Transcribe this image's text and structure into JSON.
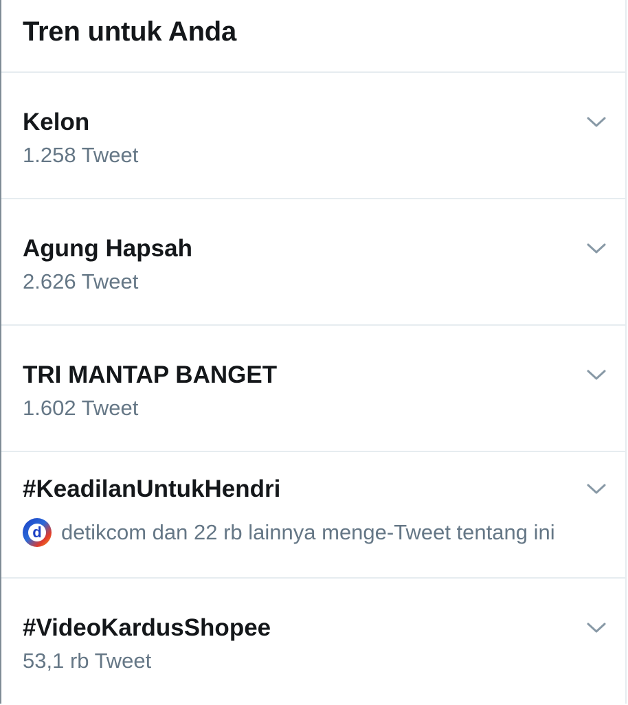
{
  "header": {
    "title": "Tren untuk Anda"
  },
  "trends": [
    {
      "name": "Kelon",
      "meta": "1.258 Tweet"
    },
    {
      "name": "Agung Hapsah",
      "meta": "2.626 Tweet"
    },
    {
      "name": "TRI MANTAP BANGET",
      "meta": "1.602 Tweet"
    },
    {
      "name": "#KeadilanUntukHendri",
      "meta": "detikcom dan 22 rb lainnya menge-Tweet tentang ini",
      "avatar_letter": "d"
    },
    {
      "name": "#VideoKardusShopee",
      "meta": "53,1 rb Tweet"
    }
  ],
  "icons": {
    "chevron": "chevron-down-icon",
    "avatar": "detikcom-avatar"
  },
  "colors": {
    "primary_text": "#14171a",
    "secondary_text": "#657786",
    "divider": "#e6ecf0",
    "chevron": "#8899a6"
  }
}
